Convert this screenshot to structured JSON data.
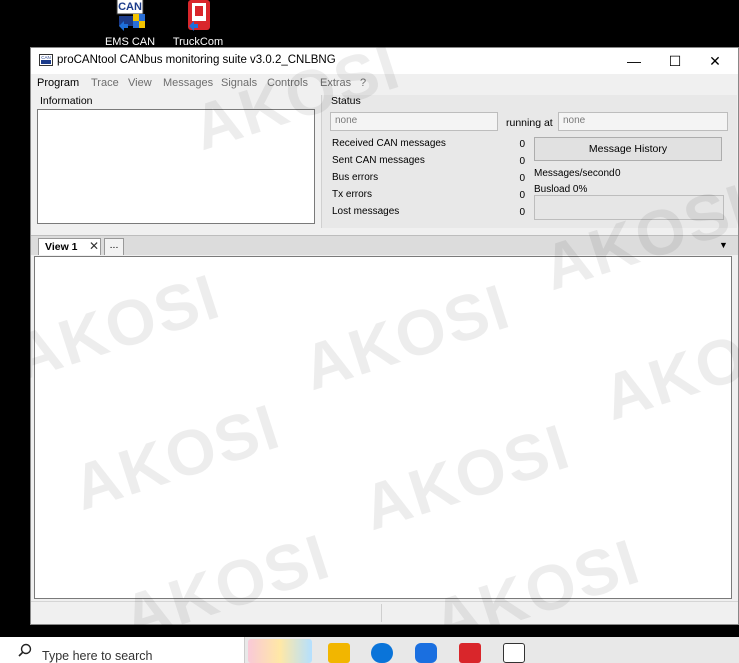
{
  "desktop": {
    "icons": [
      {
        "label": "EMS CAN"
      },
      {
        "label": "TruckCom"
      }
    ]
  },
  "window": {
    "title": "proCANtool CANbus monitoring suite v3.0.2_CNLBNG",
    "controls": {
      "minimize": "—",
      "maximize": "☐",
      "close": "✕"
    }
  },
  "menu": {
    "items": [
      "Program",
      "Trace",
      "View",
      "Messages",
      "Signals",
      "Controls",
      "Extras",
      "?"
    ]
  },
  "information": {
    "label": "Information"
  },
  "status": {
    "label": "Status",
    "interface_value": "none",
    "running_at_label": "running at",
    "running_at_value": "none",
    "rows": [
      {
        "label": "Received CAN messages",
        "value": "0"
      },
      {
        "label": "Sent CAN messages",
        "value": "0"
      },
      {
        "label": "Bus errors",
        "value": "0"
      },
      {
        "label": "Tx errors",
        "value": "0"
      },
      {
        "label": "Lost messages",
        "value": "0"
      }
    ],
    "message_history_button": "Message History",
    "messages_per_second_label": "Messages/second",
    "messages_per_second_value": "0",
    "busload": "Busload 0%"
  },
  "tabs": {
    "active": "View 1",
    "close_glyph": "✕",
    "more": "..."
  },
  "watermark": "AKOSI",
  "taskbar": {
    "search_placeholder": "Type here to search"
  },
  "colors": {
    "accent_red": "#d9262b",
    "edge_blue": "#0a74d9",
    "teamviewer_blue": "#1a6fe0"
  }
}
